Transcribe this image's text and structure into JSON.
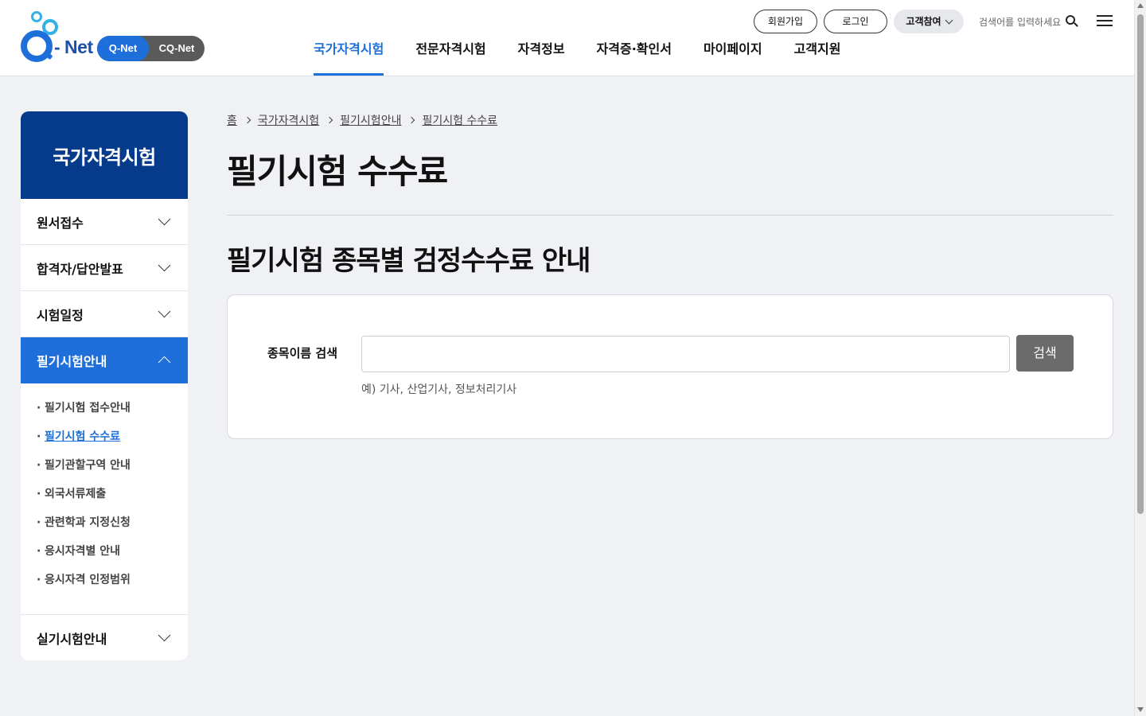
{
  "header": {
    "logo_text": "- Net",
    "switch": {
      "qnet": "Q-Net",
      "cqnet": "CQ-Net"
    },
    "gnb": [
      {
        "label": "국가자격시험",
        "active": true
      },
      {
        "label": "전문자격시험"
      },
      {
        "label": "자격정보"
      },
      {
        "label": "자격증·확인서"
      },
      {
        "label": "마이페이지"
      },
      {
        "label": "고객지원"
      }
    ],
    "util": {
      "join": "회원가입",
      "login": "로그인",
      "customer": "고객참여",
      "search_hint": "검색어를 입력하세요"
    }
  },
  "sidebar": {
    "title": "국가자격시험",
    "items": [
      {
        "label": "원서접수"
      },
      {
        "label": "합격자/답안발표"
      },
      {
        "label": "시험일정"
      },
      {
        "label": "필기시험안내",
        "active": true
      },
      {
        "label": "실기시험안내"
      }
    ],
    "subitems": [
      {
        "label": "필기시험 접수안내"
      },
      {
        "label": "필기시험 수수료",
        "active": true
      },
      {
        "label": "필기관할구역 안내"
      },
      {
        "label": "외국서류제출"
      },
      {
        "label": "관련학과 지정신청"
      },
      {
        "label": "응시자격별 안내"
      },
      {
        "label": "응시자격 인정범위"
      }
    ],
    "bullet": "·"
  },
  "breadcrumb": [
    "홈",
    "국가자격시험",
    "필기시험안내",
    "필기시험 수수료"
  ],
  "main": {
    "title": "필기시험 수수료",
    "section_title": "필기시험 종목별 검정수수료 안내",
    "search": {
      "label": "종목이름 검색",
      "value": "",
      "placeholder": "",
      "button": "검색",
      "hint": "예) 기사, 산업기사, 정보처리기사"
    }
  },
  "colors": {
    "brand_blue": "#1e6fd9",
    "navy": "#063a8a",
    "search_button": "#6b6b6b"
  }
}
